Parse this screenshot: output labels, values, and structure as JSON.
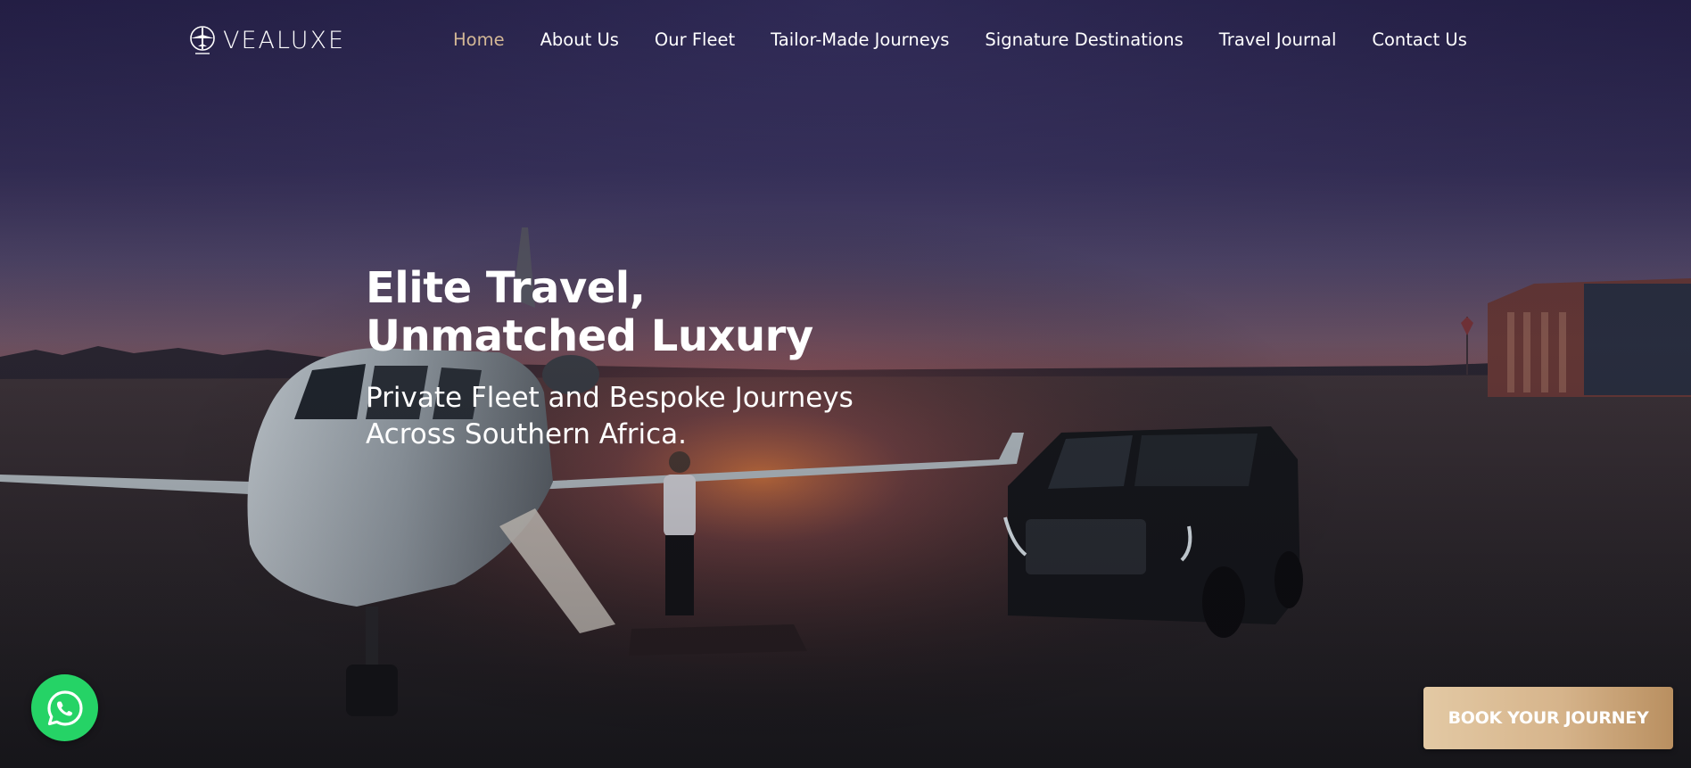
{
  "brand": {
    "name": "VEALUXE",
    "logo_icon": "airplane-globe-icon"
  },
  "nav": {
    "items": [
      {
        "label": "Home",
        "active": true
      },
      {
        "label": "About Us",
        "active": false
      },
      {
        "label": "Our Fleet",
        "active": false
      },
      {
        "label": "Tailor-Made Journeys",
        "active": false
      },
      {
        "label": "Signature Destinations",
        "active": false
      },
      {
        "label": "Travel Journal",
        "active": false
      },
      {
        "label": "Contact Us",
        "active": false
      }
    ],
    "active_color": "#d4b896"
  },
  "hero": {
    "title_line1": "Elite Travel,",
    "title_line2": "Unmatched Luxury",
    "subtitle_line1": "Private Fleet and Bespoke Journeys",
    "subtitle_line2": "Across Southern Africa."
  },
  "cta": {
    "book_label": "BOOK YOUR JOURNEY",
    "whatsapp_icon": "whatsapp-icon",
    "whatsapp_color": "#25d366"
  },
  "colors": {
    "accent_gold": "#d4b896",
    "sky_top": "#2b2550",
    "sunset": "#c2574a"
  }
}
